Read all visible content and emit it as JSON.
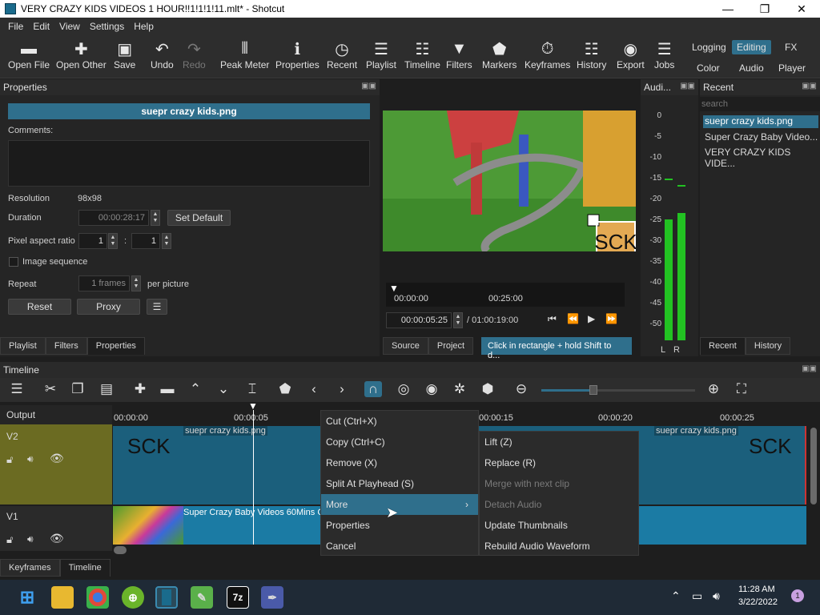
{
  "titlebar": {
    "title": "VERY CRAZY KIDS VIDEOS 1 HOUR!!1!1!1!11.mlt* - Shotcut",
    "min": "—",
    "max": "❐",
    "close": "✕"
  },
  "menu": [
    "File",
    "Edit",
    "View",
    "Settings",
    "Help"
  ],
  "toolbar": {
    "open_file": "Open File",
    "open_other": "Open Other",
    "save": "Save",
    "undo": "Undo",
    "redo": "Redo",
    "peak_meter": "Peak Meter",
    "properties": "Properties",
    "recent": "Recent",
    "playlist": "Playlist",
    "timeline": "Timeline",
    "filters": "Filters",
    "markers": "Markers",
    "keyframes": "Keyframes",
    "history": "History",
    "export": "Export",
    "jobs": "Jobs"
  },
  "modes": {
    "logging": "Logging",
    "editing": "Editing",
    "fx": "FX",
    "color": "Color",
    "audio": "Audio",
    "player": "Player"
  },
  "properties": {
    "title": "Properties",
    "filename": "suepr crazy kids.png",
    "comments_label": "Comments:",
    "resolution_label": "Resolution",
    "resolution_value": "98x98",
    "duration_label": "Duration",
    "duration_value": "00:00:28:17",
    "set_default": "Set Default",
    "par_label": "Pixel aspect ratio",
    "par_num": "1",
    "par_sep": ":",
    "par_den": "1",
    "image_sequence": "Image sequence",
    "repeat_label": "Repeat",
    "repeat_value": "1 frames",
    "per_picture": "per picture",
    "reset": "Reset",
    "proxy": "Proxy",
    "menu": "☰",
    "tabs": [
      "Playlist",
      "Filters",
      "Properties"
    ]
  },
  "viewer": {
    "watermark": "SCK",
    "ruler": [
      "00:00:00",
      "00:25:00"
    ],
    "position": "00:00:05:25",
    "duration": "/ 01:00:19:00",
    "tabs": [
      "Source",
      "Project"
    ],
    "hint": "Click in rectangle + hold Shift to d..."
  },
  "audio": {
    "title": "Audi...",
    "scale": [
      "0",
      "-5",
      "-10",
      "-15",
      "-20",
      "-25",
      "-30",
      "-35",
      "-40",
      "-45",
      "-50"
    ],
    "left": "L",
    "right": "R",
    "level_left": 0.52,
    "level_right": 0.55
  },
  "recent": {
    "title": "Recent",
    "search_placeholder": "search",
    "items": [
      "suepr crazy kids.png",
      "Super Crazy Baby Video...",
      "VERY CRAZY KIDS VIDE..."
    ],
    "tabs": [
      "Recent",
      "History"
    ]
  },
  "timeline": {
    "title": "Timeline",
    "output": "Output",
    "ruler": [
      "00:00:00",
      "00:00:05",
      "00:00:15",
      "00:00:20",
      "00:00:25"
    ],
    "tracks": [
      {
        "name": "V2"
      },
      {
        "name": "V1"
      }
    ],
    "clip_v2": "suepr crazy kids.png",
    "clip_v2_watermark": "SCK",
    "clip_v1": "Super Crazy Baby Videos 60Mins Co",
    "bottom_tabs": [
      "Keyframes",
      "Timeline"
    ]
  },
  "context_menu": {
    "items": [
      "Cut (Ctrl+X)",
      "Copy (Ctrl+C)",
      "Remove (X)",
      "Split At Playhead (S)",
      "More",
      "Properties",
      "Cancel"
    ],
    "submenu": [
      "Lift (Z)",
      "Replace (R)",
      "Merge with next clip",
      "Detach Audio",
      "Update Thumbnails",
      "Rebuild Audio Waveform"
    ]
  },
  "taskbar": {
    "time": "11:28 AM",
    "date": "3/22/2022",
    "badge": "1",
    "sevenzip": "7z"
  },
  "colors": {
    "accent": "#2f6f8c",
    "track_v2": "#6b6b22",
    "clip": "#1b5f7c",
    "meter": "#22c222"
  }
}
